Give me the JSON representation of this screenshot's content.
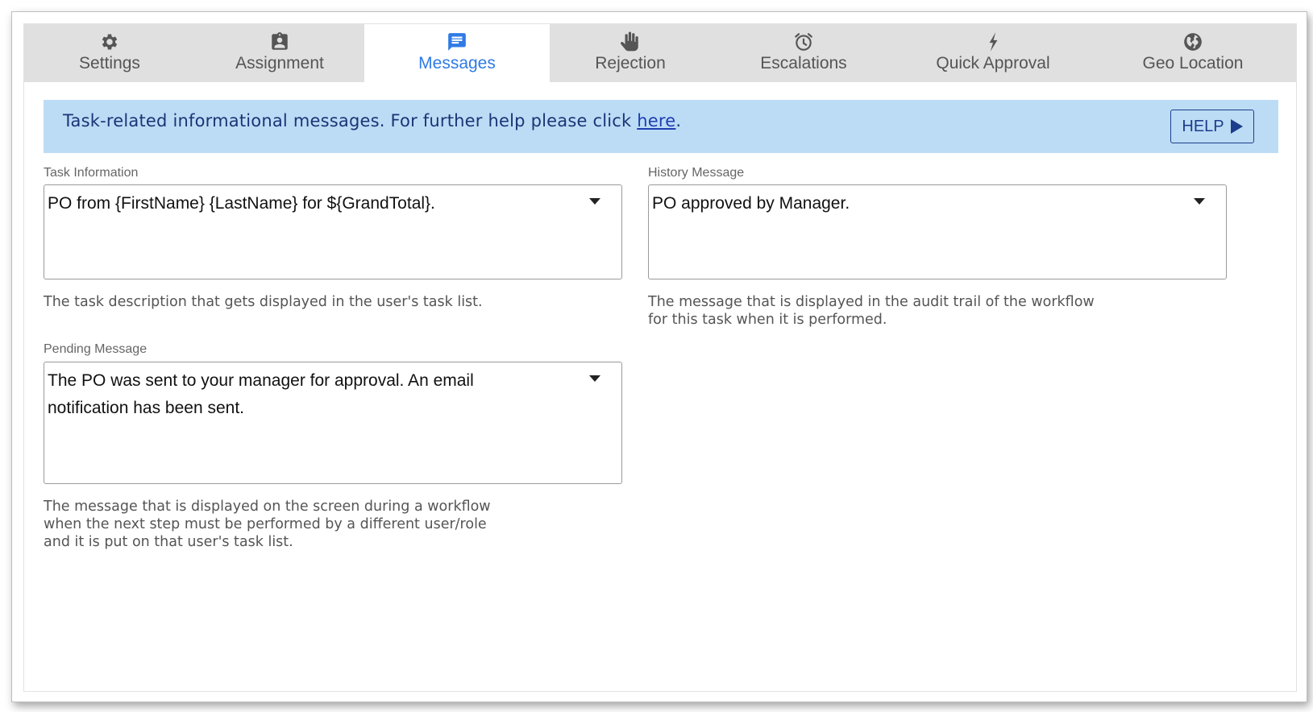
{
  "tabs": [
    {
      "label": "Settings",
      "icon": "gear-icon"
    },
    {
      "label": "Assignment",
      "icon": "clipboard-user-icon"
    },
    {
      "label": "Messages",
      "icon": "message-icon",
      "active": true
    },
    {
      "label": "Rejection",
      "icon": "hand-icon"
    },
    {
      "label": "Escalations",
      "icon": "alarm-clock-icon"
    },
    {
      "label": "Quick Approval",
      "icon": "lightning-icon"
    },
    {
      "label": "Geo Location",
      "icon": "globe-icon"
    }
  ],
  "banner": {
    "text": "Task-related informational messages. For further help please click ",
    "link": "here",
    "suffix": ".",
    "help_label": "HELP"
  },
  "fields": {
    "task_information": {
      "label": "Task Information",
      "value": "PO from {FirstName} {LastName} for ${GrandTotal}.",
      "help": "The task description that gets displayed in the user's task list."
    },
    "history_message": {
      "label": "History Message",
      "value": "PO approved by Manager.",
      "help": "The message that is displayed in the audit trail of the workflow\nfor this task when it is performed."
    },
    "pending_message": {
      "label": "Pending Message",
      "value": "The PO was sent to your manager for approval. An email notification has been sent.",
      "help": "The message that is displayed on the screen during a workflow\nwhen the next step must be performed by a different user/role\nand it is put on that user's task list."
    }
  },
  "colors": {
    "active_tab": "#2f7be5",
    "tab_bar": "#e0e0e0",
    "banner": "#bcdcf6",
    "banner_text": "#1a3575"
  }
}
